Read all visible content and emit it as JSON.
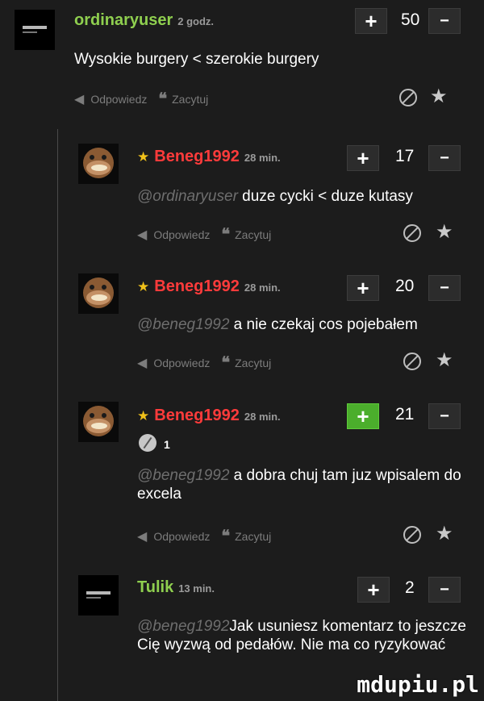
{
  "colors": {
    "nick_green": "#8fcf4f",
    "nick_red": "#ff3b3b",
    "star": "#f0c11a",
    "plus_active": "#4bae2c"
  },
  "actions": {
    "reply_label": "Odpowiedz",
    "quote_label": "Zacytuj"
  },
  "icons": {
    "reply": "reply-arrow-icon",
    "quote": "quote-icon",
    "block": "block-icon",
    "favorite": "star-icon"
  },
  "comments": [
    {
      "author": "ordinaryuser",
      "time": "2 godz.",
      "votes": "50",
      "text": "Wysokie burgery < szerokie burgery"
    },
    {
      "author": "Beneg1992",
      "time": "28 min.",
      "votes": "17",
      "mention": "@ordinaryuser",
      "text": " duze cycki < duze kutasy"
    },
    {
      "author": "Beneg1992",
      "time": "28 min.",
      "votes": "20",
      "mention": "@beneg1992",
      "text": " a nie czekaj cos pojebałem"
    },
    {
      "author": "Beneg1992",
      "time": "28 min.",
      "votes": "21",
      "pluses": "1",
      "mention": "@beneg1992",
      "text": " a dobra chuj tam juz wpisalem do excela"
    },
    {
      "author": "Tulik",
      "time": "13 min.",
      "votes": "2",
      "mention": "@beneg1992",
      "text": "Jak usuniesz komentarz to jeszcze Cię wyzwą od pedałów. Nie ma co ryzykować"
    }
  ],
  "buttons": {
    "plus": "+",
    "minus": "−"
  },
  "watermark": "mdupiu.pl"
}
